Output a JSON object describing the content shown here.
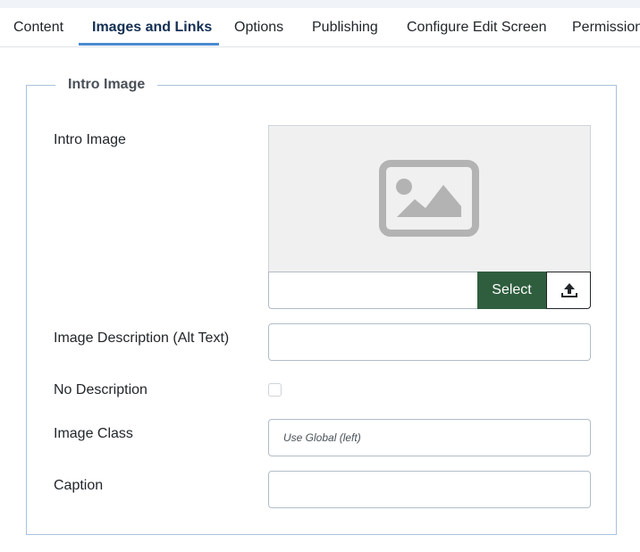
{
  "tabs": [
    {
      "label": "Content"
    },
    {
      "label": "Images and Links"
    },
    {
      "label": "Options"
    },
    {
      "label": "Publishing"
    },
    {
      "label": "Configure Edit Screen"
    },
    {
      "label": "Permissions"
    }
  ],
  "active_tab": "Images and Links",
  "fieldset": {
    "legend": "Intro Image"
  },
  "fields": {
    "intro_image": {
      "label": "Intro Image",
      "value": "",
      "select_label": "Select",
      "upload_icon": "upload-icon",
      "preview_icon": "image-placeholder-icon"
    },
    "alt_text": {
      "label": "Image Description (Alt Text)",
      "value": ""
    },
    "no_description": {
      "label": "No Description",
      "checked": false
    },
    "image_class": {
      "label": "Image Class",
      "value": "",
      "placeholder": "Use Global (left)"
    },
    "caption": {
      "label": "Caption",
      "value": ""
    }
  },
  "colors": {
    "select_button": "#2f5e3e",
    "active_tab_text": "#132f53",
    "active_tab_underline": "#4c8bd0",
    "fieldset_border": "#aac2de"
  }
}
